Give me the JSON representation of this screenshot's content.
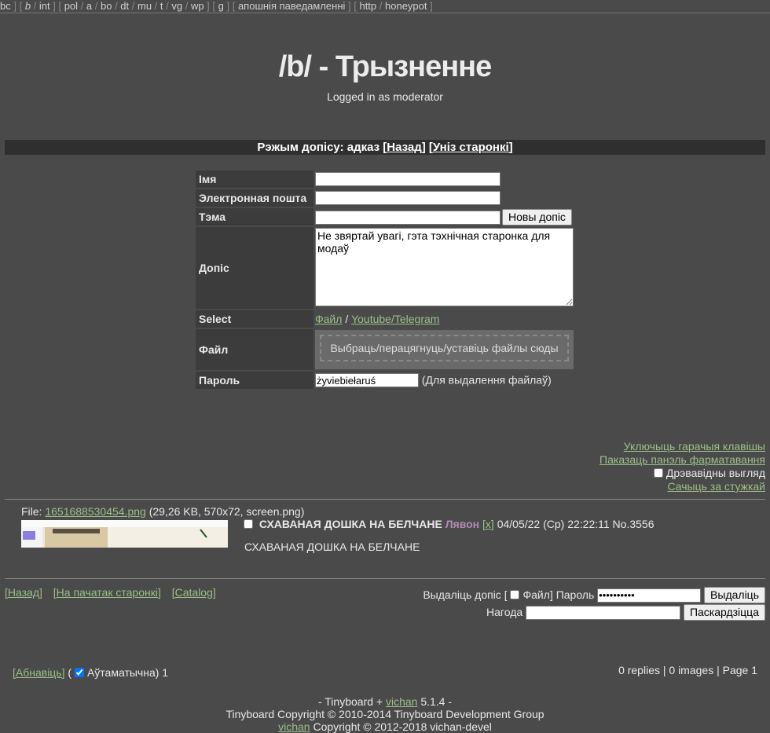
{
  "boardlist": {
    "groups": [
      [
        "bc"
      ],
      [
        "b",
        "int"
      ],
      [
        "pol",
        "a",
        "bo",
        "dt",
        "mu",
        "t",
        "vg",
        "wp"
      ],
      [
        "g"
      ],
      [
        "апошнія паведамленні"
      ],
      [
        "http",
        "honeypot"
      ]
    ]
  },
  "header": {
    "title": "/b/ - Трызненне",
    "subtitle": "Logged in as moderator"
  },
  "mode_bar": {
    "label": "Рэжым допісу: адказ",
    "back_link": "Назад",
    "bottom_link": "Уніз старонкі"
  },
  "form": {
    "name_label": "Імя",
    "email_label": "Электронная пошта",
    "subject_label": "Тэма",
    "submit_button": "Новы допіс",
    "comment_label": "Допіс",
    "comment_value": "Не звяртай увагі, гэта тэхнічная старонка для модаў",
    "select_label": "Select",
    "select_file_link": "Файл",
    "select_slash": "/",
    "select_youtube_link": "Youtube/Telegram",
    "file_label": "Файл",
    "dropzone_text": "Выбраць/перацягнуць/уставіць файлы сюды",
    "password_label": "Пароль",
    "password_value": "żyviebiełaruś",
    "password_hint": "(Для выдалення файлаў)"
  },
  "options": {
    "hotkeys_link": "Уключыць гарачыя клавішы",
    "formatting_link": "Паказаць панэль фарматавання",
    "tree_view_label": "Дрэвавідны выгляд",
    "watch_link": "Сачыць за стужкай"
  },
  "post": {
    "file_prefix": "File:",
    "file_name": "1651688530454.png",
    "file_meta": "(29,26 KB, 570x72, screen.png)",
    "subject": "СХАВАНАЯ ДОШКА НА БЕЛЧАНЕ",
    "name": "Лявон",
    "delete_marker": "[x]",
    "date": "04/05/22 (Ср) 22:22:11",
    "number": "No.3556",
    "body": "СХАВАНАЯ ДОШКА НА БЕЛЧАНЕ"
  },
  "bottom_nav": {
    "back": "[Назад]",
    "top": "[На пачатак старонкі]",
    "catalog": "[Catalog]"
  },
  "delete_form": {
    "prefix": "Выдаліць допіс [",
    "file_label": "Файл]",
    "password_label": "Пароль",
    "password_value": "••••••••••",
    "delete_button": "Выдаліць",
    "reason_label": "Нагода",
    "report_button": "Паскардзіцца"
  },
  "refresh": {
    "link": "[Абнавіць]",
    "open_paren": "(",
    "auto_label": "Аўтаматычна)",
    "counter": "1"
  },
  "page_count": "0 replies | 0 images | Page 1",
  "footer": {
    "line1_prefix": "- Tinyboard +",
    "line1_link": "vichan",
    "line1_suffix": "5.1.4 -",
    "line2": "Tinyboard Copyright © 2010-2014 Tinyboard Development Group",
    "line3_link": "vichan",
    "line3_suffix": "Copyright © 2012-2018 vichan-devel"
  }
}
